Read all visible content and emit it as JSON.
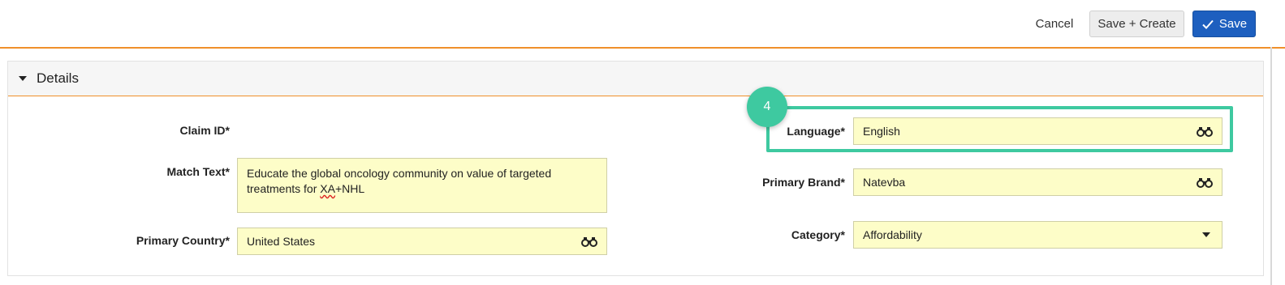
{
  "toolbar": {
    "cancel_label": "Cancel",
    "save_create_label": "Save + Create",
    "save_label": "Save"
  },
  "section": {
    "title": "Details"
  },
  "fields": {
    "claim_id": {
      "label": "Claim ID*",
      "value": ""
    },
    "match_text": {
      "label": "Match Text*",
      "value_part1": "Educate the global oncology community on value of targeted treatments for ",
      "value_misspelled": "XA",
      "value_part2": "+NHL"
    },
    "primary_country": {
      "label": "Primary Country*",
      "value": "United States"
    },
    "language": {
      "label": "Language*",
      "value": "English"
    },
    "primary_brand": {
      "label": "Primary Brand*",
      "value": "Natevba"
    },
    "category": {
      "label": "Category*",
      "value": "Affordability"
    }
  },
  "annotation": {
    "step_number": "4"
  },
  "colors": {
    "accent_orange": "#f0902a",
    "primary_blue": "#1d5fbf",
    "field_yellow": "#fdfdc8",
    "highlight_green": "#3ec9a0"
  }
}
